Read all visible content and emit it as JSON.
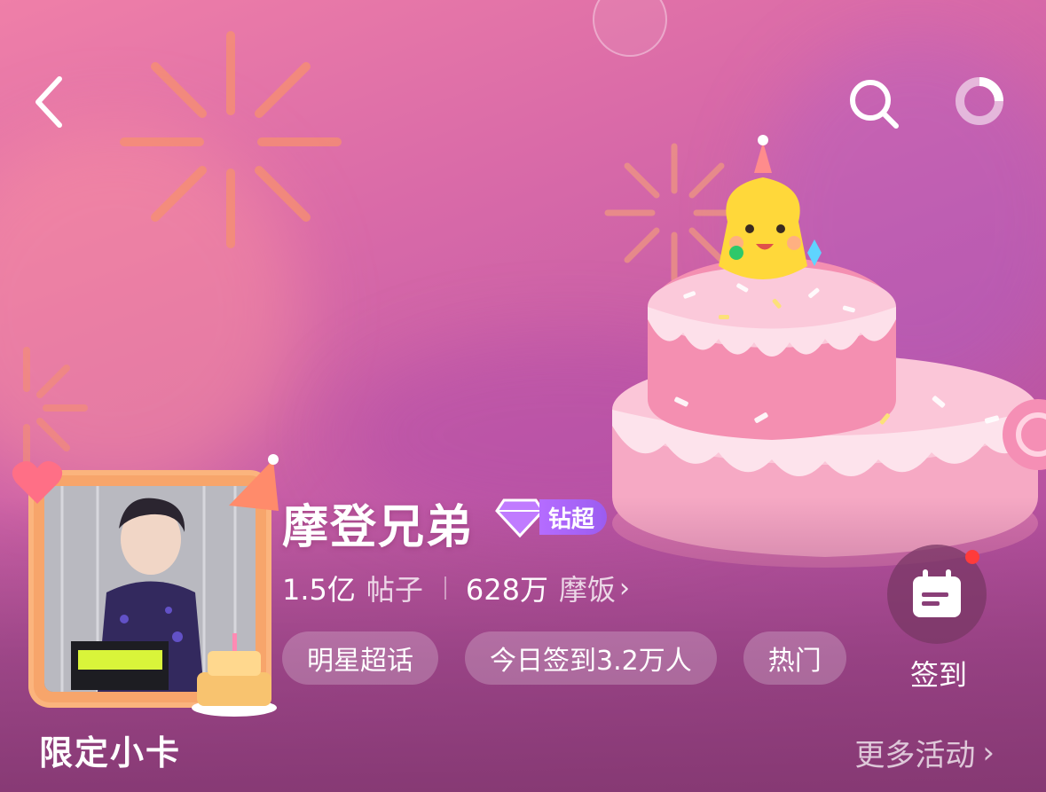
{
  "header": {
    "back_icon": "chevron-left-icon",
    "search_icon": "search-icon",
    "more_icon": "loading-ring-icon"
  },
  "topic": {
    "name": "摩登兄弟",
    "badge_label": "钻超",
    "badge_icon": "diamond-icon",
    "posts_count": "1.5亿",
    "posts_unit": "帖子",
    "fans_count": "628万",
    "fans_unit": "摩饭",
    "fans_chevron": "›"
  },
  "tags": [
    {
      "label": "明星超话"
    },
    {
      "label": "今日签到3.2万人"
    },
    {
      "label": "热门"
    }
  ],
  "checkin": {
    "label": "签到",
    "icon": "calendar-icon",
    "has_notification_dot": true
  },
  "section": {
    "title": "限定小卡",
    "more_label": "更多活动",
    "more_chevron": "›"
  },
  "colors": {
    "background_top": "#ef7fa8",
    "background_bottom": "#a9478f",
    "badge_purple": "#9b5cf0",
    "notification_red": "#ff3b3b",
    "cake_pink": "#f6a9c4"
  }
}
